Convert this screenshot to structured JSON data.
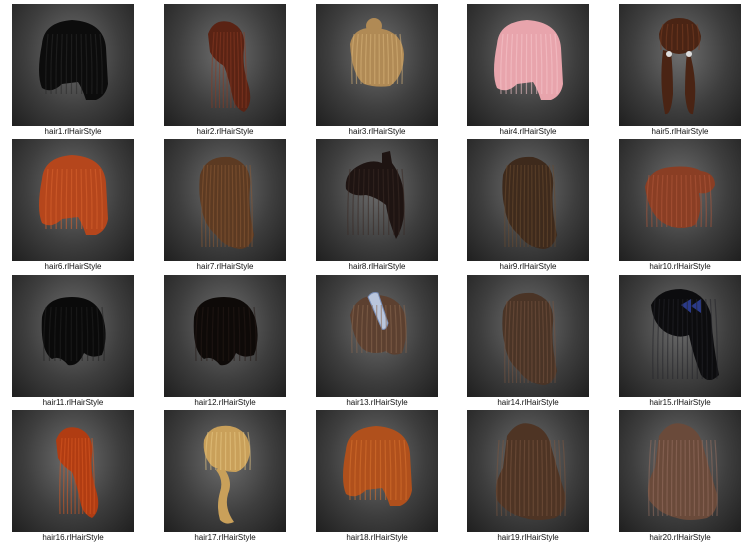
{
  "items": [
    {
      "label": "hair1.rlHairStyle",
      "color": "#0c0c0c",
      "shade": "#2a2a2a",
      "shape": "bob",
      "icon": "hair-thumbnail-icon"
    },
    {
      "label": "hair2.rlHairStyle",
      "color": "#5a2314",
      "shade": "#8b3a22",
      "shape": "pony-side",
      "icon": "hair-thumbnail-icon"
    },
    {
      "label": "hair3.rlHairStyle",
      "color": "#b08a55",
      "shade": "#d8b57a",
      "shape": "bun-short",
      "icon": "hair-thumbnail-icon"
    },
    {
      "label": "hair4.rlHairStyle",
      "color": "#e8a4ac",
      "shade": "#f5c7cc",
      "shape": "bob",
      "icon": "hair-thumbnail-icon"
    },
    {
      "label": "hair5.rlHairStyle",
      "color": "#4a2414",
      "shade": "#7a3e22",
      "shape": "pigtails",
      "icon": "hair-thumbnail-icon"
    },
    {
      "label": "hair6.rlHairStyle",
      "color": "#b5461c",
      "shade": "#d9642f",
      "shape": "bob",
      "icon": "hair-thumbnail-icon"
    },
    {
      "label": "hair7.rlHairStyle",
      "color": "#5c3a22",
      "shade": "#8a5a34",
      "shape": "long",
      "icon": "hair-thumbnail-icon"
    },
    {
      "label": "hair8.rlHairStyle",
      "color": "#1e1412",
      "shade": "#3a2a24",
      "shape": "pony-up",
      "icon": "hair-thumbnail-icon"
    },
    {
      "label": "hair9.rlHairStyle",
      "color": "#3e2a1c",
      "shade": "#6a4a30",
      "shape": "long",
      "icon": "hair-thumbnail-icon"
    },
    {
      "label": "hair10.rlHairStyle",
      "color": "#8a3e24",
      "shade": "#b0573a",
      "shape": "short-pony",
      "icon": "hair-thumbnail-icon"
    },
    {
      "label": "hair11.rlHairStyle",
      "color": "#0a0a0a",
      "shade": "#222222",
      "shape": "short",
      "icon": "hair-thumbnail-icon"
    },
    {
      "label": "hair12.rlHairStyle",
      "color": "#0e0a08",
      "shade": "#261c18",
      "shape": "short",
      "icon": "hair-thumbnail-icon"
    },
    {
      "label": "hair13.rlHairStyle",
      "color": "#5c4030",
      "shade": "#8a6850",
      "shape": "headband",
      "icon": "hair-thumbnail-icon"
    },
    {
      "label": "hair14.rlHairStyle",
      "color": "#4a3426",
      "shade": "#765440",
      "shape": "long",
      "icon": "hair-thumbnail-icon"
    },
    {
      "label": "hair15.rlHairStyle",
      "color": "#0c0c0e",
      "shade": "#24242a",
      "shape": "bow",
      "icon": "hair-thumbnail-icon"
    },
    {
      "label": "hair16.rlHairStyle",
      "color": "#b03c12",
      "shade": "#d95a22",
      "shape": "pony-side",
      "icon": "hair-thumbnail-icon"
    },
    {
      "label": "hair17.rlHairStyle",
      "color": "#c9a05a",
      "shade": "#e8c985",
      "shape": "braid",
      "icon": "hair-thumbnail-icon"
    },
    {
      "label": "hair18.rlHairStyle",
      "color": "#b0501c",
      "shade": "#d9732f",
      "shape": "bob",
      "icon": "hair-thumbnail-icon"
    },
    {
      "label": "hair19.rlHairStyle",
      "color": "#4e3424",
      "shade": "#7a5640",
      "shape": "curly",
      "icon": "hair-thumbnail-icon"
    },
    {
      "label": "hair20.rlHairStyle",
      "color": "#6a4a3a",
      "shade": "#957060",
      "shape": "curly",
      "icon": "hair-thumbnail-icon"
    }
  ]
}
